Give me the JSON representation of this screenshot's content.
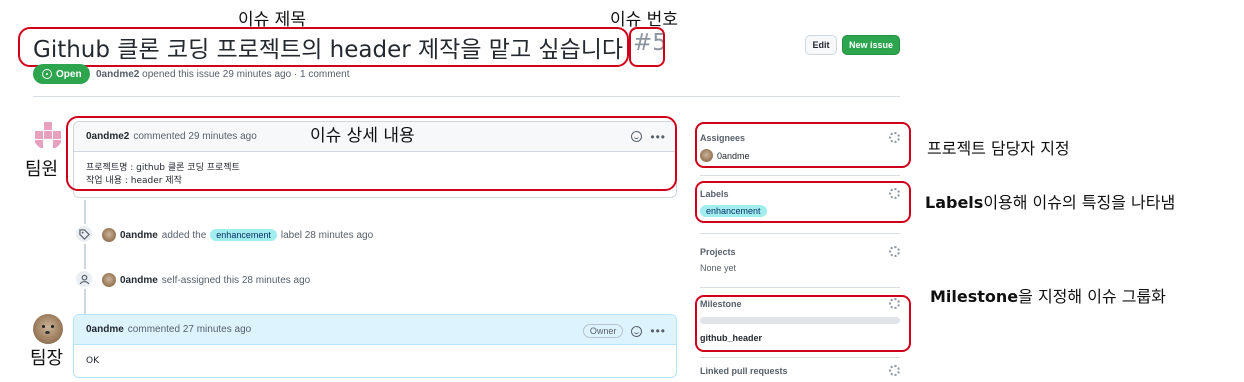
{
  "annotations": {
    "issue_title": "이슈 제목",
    "issue_number": "이슈 번호",
    "issue_detail": "이슈 상세 내용",
    "team_member": "팀원",
    "team_leader": "팀장",
    "assignees": "프로젝트 담당자 지정",
    "labels_bold": "Labels",
    "labels_rest": "이용해 이슈의 특징을 나타냄",
    "milestone_bold": "Milestone",
    "milestone_rest": "을 지정해 이슈 그룹화"
  },
  "issue": {
    "title": "Github 클론 코딩 프로젝트의 header 제작을 맡고 싶습니다",
    "number": "#5",
    "state": "Open",
    "author": "0andme2",
    "meta_text": "opened this issue 29 minutes ago · 1 comment"
  },
  "header_buttons": {
    "edit": "Edit",
    "new_issue": "New issue"
  },
  "comments": [
    {
      "author": "0andme2",
      "time": "commented 29 minutes ago",
      "body_lines": [
        "프로젝트명 : github 클론 코딩 프로젝트",
        "작업 내용 : header 제작"
      ]
    },
    {
      "author": "0andme",
      "time": "commented 27 minutes ago",
      "badge": "Owner",
      "body_lines": [
        "OK"
      ]
    }
  ],
  "timeline": [
    {
      "user": "0andme",
      "before": "added the",
      "label": "enhancement",
      "after": "label 28 minutes ago",
      "icon": "tag-icon"
    },
    {
      "user": "0andme",
      "text": "self-assigned this 28 minutes ago",
      "icon": "person-icon"
    }
  ],
  "sidebar": {
    "assignees": {
      "title": "Assignees",
      "value": "0andme"
    },
    "labels": {
      "title": "Labels",
      "value": "enhancement"
    },
    "projects": {
      "title": "Projects",
      "value": "None yet"
    },
    "milestone": {
      "title": "Milestone",
      "value": "github_header",
      "progress": 0
    },
    "linked": {
      "title": "Linked pull requests"
    }
  },
  "colors": {
    "open_green": "#2da44e",
    "label_enhancement": "#a2eeef",
    "annotation_red": "#d0021b"
  }
}
